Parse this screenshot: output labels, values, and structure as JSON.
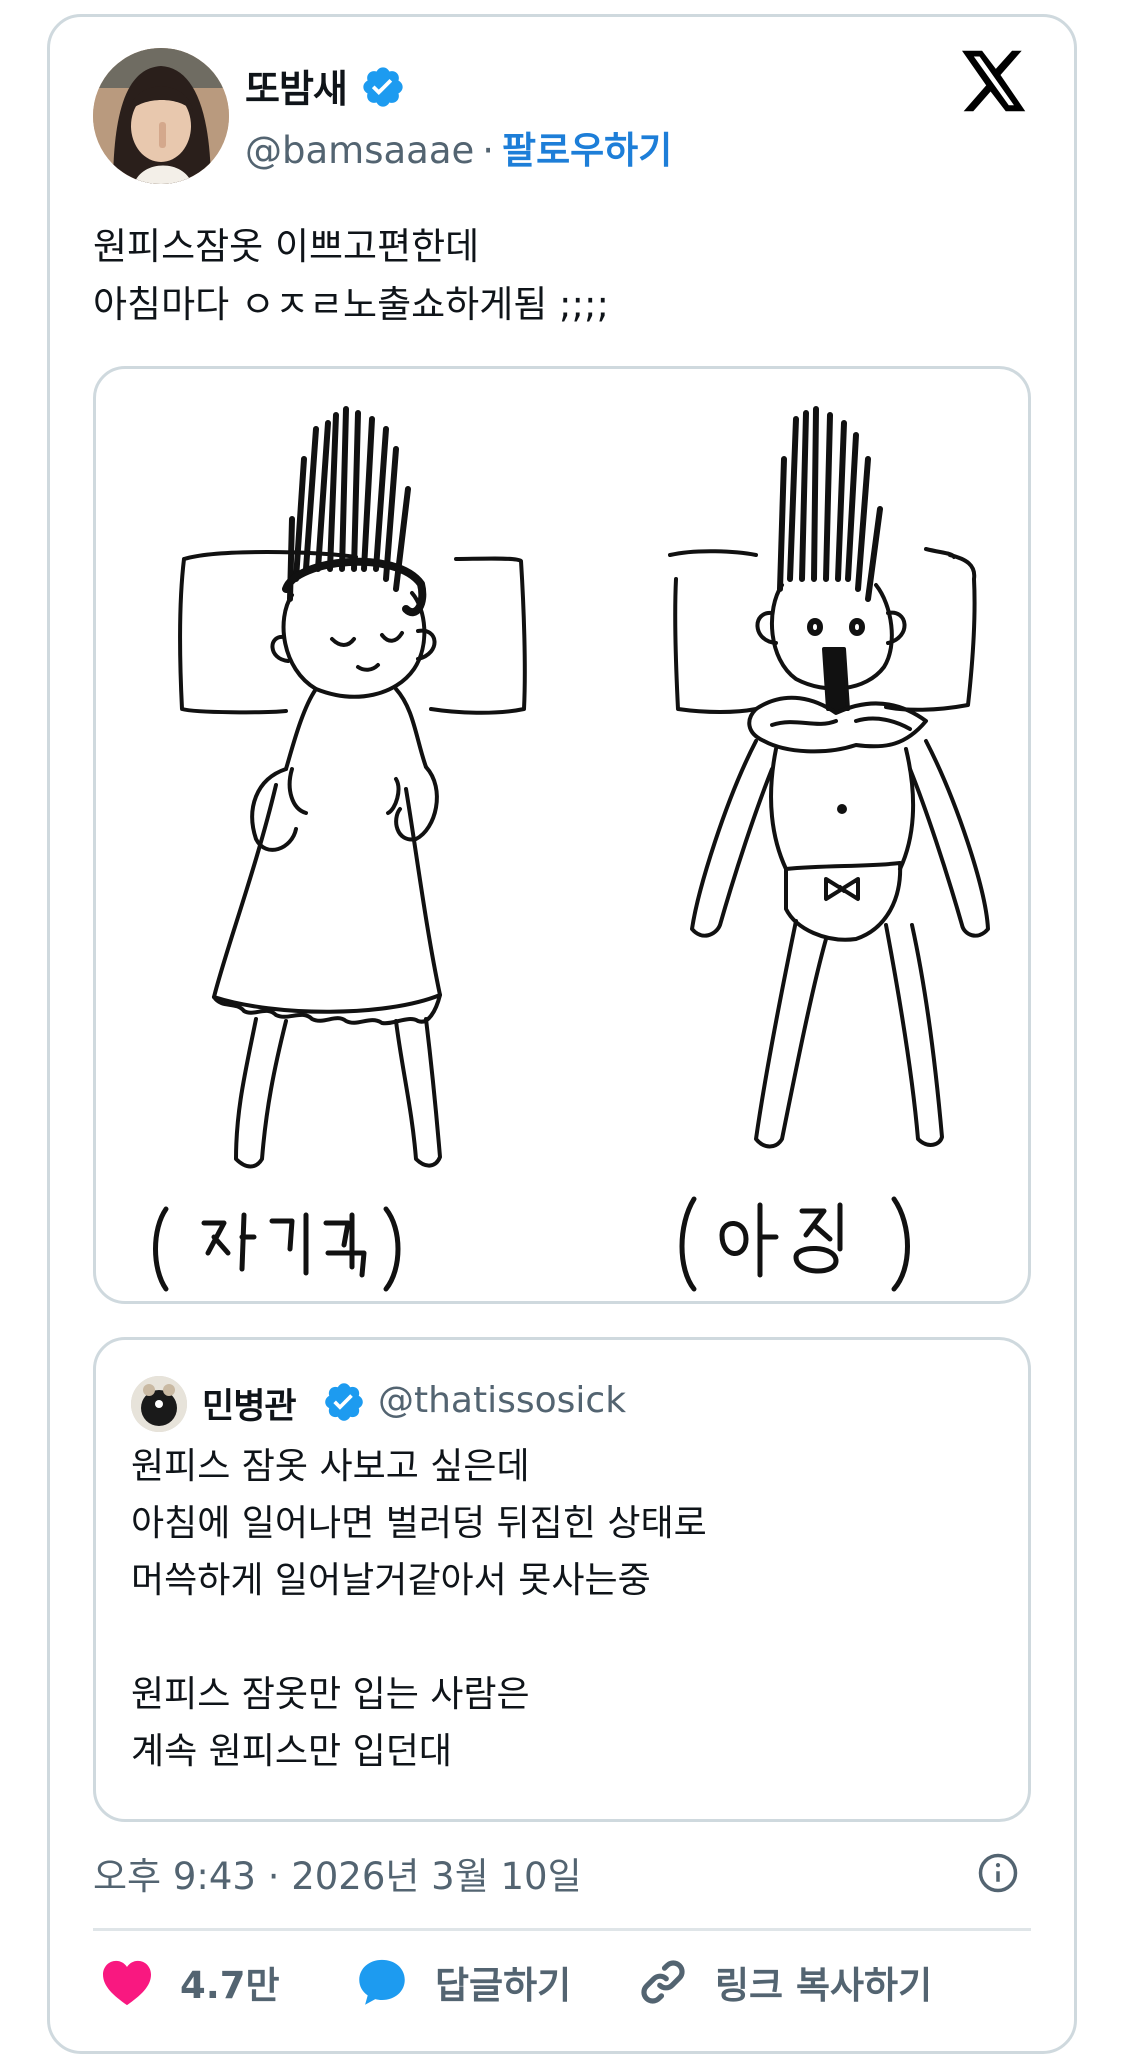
{
  "author": {
    "name": "또밤새",
    "handle": "@bamsaaae",
    "separator": "·",
    "follow_label": "팔로우하기"
  },
  "tweet": {
    "text": "원피스잠옷 이쁘고편한데\n아침마다 ㅇㅈㄹ노출쇼하게됨 ;;;;"
  },
  "media": {
    "left_caption": "(자기전)",
    "right_caption": "(아침)"
  },
  "quoted": {
    "name": "민병관",
    "handle": "@thatissosick",
    "text": "원피스 잠옷 사보고 싶은데\n아침에 일어나면 벌러덩 뒤집힌 상태로\n머쓱하게 일어날거같아서 못사는중\n\n원피스 잠옷만 입는 사람은\n계속 원피스만 입던대"
  },
  "timestamp": "오후 9:43 · 2026년 3월 10일",
  "actions": {
    "likes": "4.7만",
    "reply_label": "답글하기",
    "copy_link_label": "링크 복사하기"
  },
  "colors": {
    "like": "#f91880",
    "reply": "#1d9bf0",
    "verified": "#1d9bf0",
    "follow": "#1d7ed8",
    "secondary_text": "#536471",
    "border": "#cfd9de"
  },
  "icons": [
    "x-logo-icon",
    "verified-badge-icon",
    "info-icon",
    "heart-icon",
    "reply-bubble-icon",
    "link-icon"
  ]
}
